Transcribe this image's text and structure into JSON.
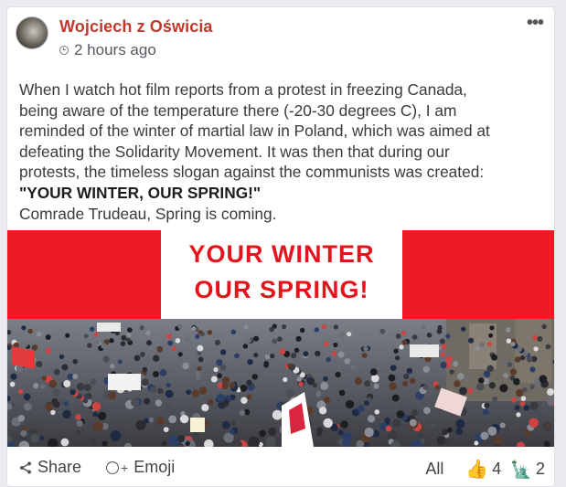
{
  "post": {
    "author": "Wojciech z Oświcia",
    "time": "2 hours ago",
    "more_label": "•••",
    "text_lines": [
      "When I watch hot film reports from a protest in freezing Canada,",
      "being aware of the temperature there (-20-30 degrees C), I am",
      "reminded of the winter of martial law in Poland, which was aimed at",
      "defeating the Solidarity Movement. It was then that during our",
      "protests, the timeless slogan against the communists was created:"
    ],
    "slogan": "\"YOUR WINTER, OUR SPRING!\"",
    "closing": "Comrade Trudeau, Spring is coming."
  },
  "image": {
    "banner_line1": "YOUR WINTER",
    "banner_line2": "OUR SPRING!",
    "colors": {
      "banner_red": "#ed1c24",
      "text_red": "#e3141c"
    }
  },
  "footer": {
    "share_label": "Share",
    "emoji_label": "Emoji",
    "all_label": "All",
    "reactions": [
      {
        "icon": "thumbs-up-icon",
        "glyph": "👍",
        "count": "4"
      },
      {
        "icon": "statue-of-liberty-icon",
        "glyph": "🗽",
        "count": "2"
      }
    ]
  },
  "colors": {
    "author": "#c0392b"
  }
}
